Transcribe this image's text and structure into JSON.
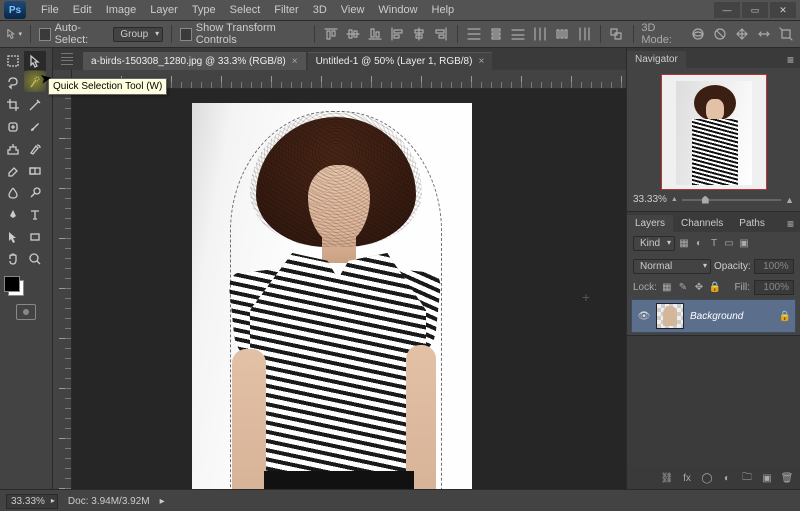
{
  "menubar": {
    "items": [
      "File",
      "Edit",
      "Image",
      "Layer",
      "Type",
      "Select",
      "Filter",
      "3D",
      "View",
      "Window",
      "Help"
    ]
  },
  "optionsbar": {
    "auto_select_label": "Auto-Select:",
    "scope": "Group",
    "show_transform_label": "Show Transform Controls",
    "mode_label": "3D Mode:"
  },
  "tabs": [
    {
      "label": "a-birds-150308_1280.jpg @ 33.3% (RGB/8)",
      "active": true
    },
    {
      "label": "Untitled-1 @ 50% (Layer 1, RGB/8)",
      "active": false
    }
  ],
  "tooltip": "Quick Selection Tool (W)",
  "statusbar": {
    "zoom": "33.33%",
    "doc_label": "Doc:",
    "doc_value": "3.94M/3.92M"
  },
  "navigator": {
    "tab": "Navigator",
    "zoom": "33.33%"
  },
  "layers_panel": {
    "tabs": [
      "Layers",
      "Channels",
      "Paths"
    ],
    "filter_label": "Kind",
    "blend": "Normal",
    "opacity_label": "Opacity:",
    "opacity_value": "100%",
    "lock_label": "Lock:",
    "fill_label": "Fill:",
    "fill_value": "100%",
    "layer": {
      "name": "Background",
      "visible": true,
      "locked": true
    }
  }
}
